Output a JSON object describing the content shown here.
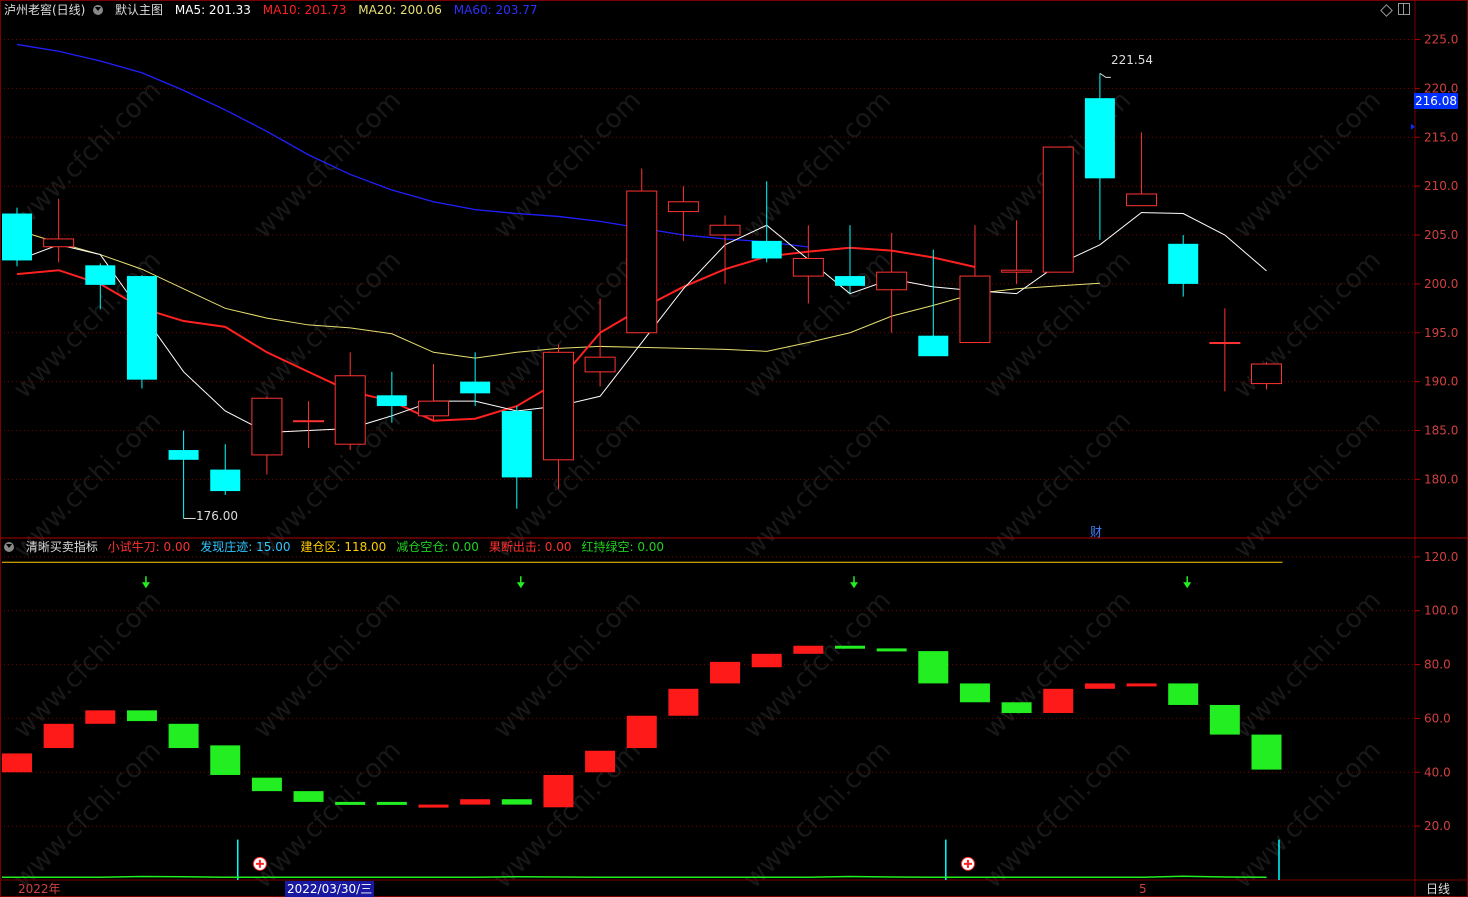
{
  "header": {
    "stock_name": "泸州老窖(日线)",
    "main_chart_label": "默认主图",
    "ma5_label": "MA5: 201.33",
    "ma10_label": "MA10: 201.73",
    "ma20_label": "MA20: 200.06",
    "ma60_label": "MA60: 203.77"
  },
  "indicator_header": {
    "name": "清晰买卖指标",
    "items": [
      {
        "text": "小试牛刀: 0.00",
        "color": "#ff3030"
      },
      {
        "text": "发现庄迹: 15.00",
        "color": "#2ec8ff"
      },
      {
        "text": "建仓区: 118.00",
        "color": "#ffcc00"
      },
      {
        "text": "减仓空仓: 0.00",
        "color": "#20d020"
      },
      {
        "text": "果断出击: 0.00",
        "color": "#ff3030"
      },
      {
        "text": "红持绿空: 0.00",
        "color": "#20d020"
      }
    ]
  },
  "price_tag": "216.08",
  "max_label": "221.54",
  "min_label": "176.00",
  "fin_marker": "财",
  "dates": {
    "start": "2022年",
    "cursor": "2022/03/30/三",
    "mark": "5"
  },
  "period_label": "日线",
  "watermark": "www.cfchi.com",
  "colors": {
    "up": "#ff3232",
    "down": "#00ffff",
    "ma5": "#ffffff",
    "ma10": "#ff2020",
    "ma20": "#e8e070",
    "ma60": "#2020ff",
    "grid": "#7a0000"
  },
  "chart_data": [
    {
      "type": "candlestick",
      "title": "泸州老窖(日线)",
      "ylim": [
        174,
        227
      ],
      "yticks": [
        "225.0",
        "220.0",
        "215.0",
        "210.0",
        "205.0",
        "200.0",
        "195.0",
        "190.0",
        "185.0",
        "180.0"
      ],
      "candles": [
        {
          "o": 207.2,
          "c": 202.4,
          "h": 207.8,
          "l": 201.8
        },
        {
          "o": 203.8,
          "c": 204.6,
          "h": 208.7,
          "l": 202.2
        },
        {
          "o": 201.9,
          "c": 199.9,
          "h": 202.1,
          "l": 197.4
        },
        {
          "o": 200.8,
          "c": 190.2,
          "h": 200.9,
          "l": 189.3
        },
        {
          "o": 183.0,
          "c": 182.0,
          "h": 185.0,
          "l": 176.0
        },
        {
          "o": 181.0,
          "c": 178.8,
          "h": 183.6,
          "l": 178.4
        },
        {
          "o": 182.5,
          "c": 188.3,
          "h": 188.5,
          "l": 180.5
        },
        {
          "o": 186.0,
          "c": 186.0,
          "h": 188.0,
          "l": 183.2
        },
        {
          "o": 183.6,
          "c": 190.6,
          "h": 193.0,
          "l": 183.0
        },
        {
          "o": 188.6,
          "c": 187.5,
          "h": 191.0,
          "l": 185.8
        },
        {
          "o": 186.5,
          "c": 188.0,
          "h": 191.8,
          "l": 186.0
        },
        {
          "o": 190.0,
          "c": 188.8,
          "h": 193.0,
          "l": 187.5
        },
        {
          "o": 187.0,
          "c": 180.2,
          "h": 187.5,
          "l": 177.0
        },
        {
          "o": 182.0,
          "c": 193.0,
          "h": 193.8,
          "l": 179.0
        },
        {
          "o": 191.0,
          "c": 192.5,
          "h": 198.5,
          "l": 189.5
        },
        {
          "o": 195.0,
          "c": 209.5,
          "h": 211.8,
          "l": 195.0
        },
        {
          "o": 207.4,
          "c": 208.4,
          "h": 210.0,
          "l": 204.4
        },
        {
          "o": 205.0,
          "c": 206.0,
          "h": 207.0,
          "l": 200.0
        },
        {
          "o": 204.4,
          "c": 202.6,
          "h": 210.5,
          "l": 202.2
        },
        {
          "o": 200.8,
          "c": 202.6,
          "h": 206.0,
          "l": 198.0
        },
        {
          "o": 200.8,
          "c": 199.8,
          "h": 206.0,
          "l": 199.0
        },
        {
          "o": 199.4,
          "c": 201.2,
          "h": 205.2,
          "l": 195.0
        },
        {
          "o": 194.7,
          "c": 192.6,
          "h": 203.5,
          "l": 192.6
        },
        {
          "o": 194.0,
          "c": 200.8,
          "h": 206.0,
          "l": 194.0
        },
        {
          "o": 201.2,
          "c": 201.4,
          "h": 206.5,
          "l": 200.0
        },
        {
          "o": 201.2,
          "c": 214.0,
          "h": 214.0,
          "l": 201.2
        },
        {
          "o": 219.0,
          "c": 210.8,
          "h": 221.54,
          "l": 204.5
        },
        {
          "o": 208.0,
          "c": 209.2,
          "h": 215.5,
          "l": 208.0
        },
        {
          "o": 204.1,
          "c": 200.0,
          "h": 205.0,
          "l": 198.7
        },
        {
          "o": 194.0,
          "c": 194.0,
          "h": 197.5,
          "l": 189.0
        },
        {
          "o": 189.8,
          "c": 191.8,
          "h": 192.0,
          "l": 189.2
        }
      ],
      "ma5": [
        202.4,
        204.0,
        203.0,
        197.0,
        191.0,
        187.0,
        184.8,
        185.0,
        185.2,
        186.5,
        188.0,
        188.0,
        187.0,
        187.5,
        188.5,
        194.0,
        199.5,
        204.0,
        206.0,
        202.5,
        199.0,
        200.5,
        199.7,
        199.3,
        199.0,
        202.0,
        204.0,
        207.3,
        207.2,
        205.0,
        201.33
      ],
      "ma10": [
        201.0,
        201.4,
        200.0,
        197.5,
        196.2,
        195.6,
        193.0,
        191.0,
        189.0,
        188.0,
        186.0,
        186.2,
        187.5,
        190.0,
        195.0,
        197.5,
        199.7,
        201.5,
        202.8,
        203.3,
        203.7,
        203.4,
        202.7,
        201.73
      ],
      "ma20": [
        205.5,
        204.2,
        203.0,
        201.5,
        199.5,
        197.5,
        196.5,
        195.8,
        195.5,
        194.9,
        193.0,
        192.4,
        193.0,
        193.4,
        193.6,
        193.5,
        193.4,
        193.3,
        193.1,
        194.0,
        195.0,
        196.7,
        197.8,
        199.0,
        199.5,
        199.8,
        200.06
      ],
      "ma60": [
        224.5,
        223.8,
        222.8,
        221.6,
        219.8,
        217.8,
        215.6,
        213.2,
        211.2,
        209.6,
        208.4,
        207.6,
        207.2,
        206.9,
        206.4,
        205.7,
        205.0,
        204.6,
        204.3,
        203.77
      ]
    },
    {
      "type": "bar",
      "title": "清晰买卖指标",
      "ylim": [
        0,
        127
      ],
      "yticks": [
        "120.0",
        "100.0",
        "80.0",
        "60.0",
        "40.0",
        "20.0"
      ],
      "boxes": [
        {
          "a": 40,
          "b": 47,
          "color": "red"
        },
        {
          "a": 49,
          "b": 58,
          "color": "red"
        },
        {
          "a": 58,
          "b": 63,
          "color": "red"
        },
        {
          "a": 63,
          "b": 59,
          "color": "green"
        },
        {
          "a": 58,
          "b": 49,
          "color": "green"
        },
        {
          "a": 50,
          "b": 39,
          "color": "green"
        },
        {
          "a": 38,
          "b": 33,
          "color": "green"
        },
        {
          "a": 33,
          "b": 29,
          "color": "green"
        },
        {
          "a": 29,
          "b": 28,
          "color": "green"
        },
        {
          "a": 29,
          "b": 28,
          "color": "green"
        },
        {
          "a": 27,
          "b": 28,
          "color": "red"
        },
        {
          "a": 28,
          "b": 30,
          "color": "red"
        },
        {
          "a": 30,
          "b": 28,
          "color": "green"
        },
        {
          "a": 27,
          "b": 39,
          "color": "red"
        },
        {
          "a": 40,
          "b": 48,
          "color": "red"
        },
        {
          "a": 49,
          "b": 61,
          "color": "red"
        },
        {
          "a": 61,
          "b": 71,
          "color": "red"
        },
        {
          "a": 73,
          "b": 81,
          "color": "red"
        },
        {
          "a": 79,
          "b": 84,
          "color": "red"
        },
        {
          "a": 84,
          "b": 87,
          "color": "red"
        },
        {
          "a": 87,
          "b": 86,
          "color": "green"
        },
        {
          "a": 86,
          "b": 85,
          "color": "green"
        },
        {
          "a": 85,
          "b": 73,
          "color": "green"
        },
        {
          "a": 73,
          "b": 66,
          "color": "green"
        },
        {
          "a": 66,
          "b": 62,
          "color": "green"
        },
        {
          "a": 62,
          "b": 71,
          "color": "red"
        },
        {
          "a": 71,
          "b": 73,
          "color": "red"
        },
        {
          "a": 73,
          "b": 73,
          "color": "red"
        },
        {
          "a": 73,
          "b": 65,
          "color": "green"
        },
        {
          "a": 65,
          "b": 54,
          "color": "green"
        },
        {
          "a": 54,
          "b": 41,
          "color": "green"
        }
      ],
      "threshold": 118,
      "down_arrows": [
        3,
        12,
        20,
        28
      ],
      "cyan_spikes": [
        {
          "i": 5,
          "v": 15
        },
        {
          "i": 22,
          "v": 15
        },
        {
          "i": 30,
          "v": 15
        }
      ],
      "cross_marks": [
        6,
        23
      ],
      "green_baseline": [
        1,
        1,
        1,
        1.3,
        1.2,
        1,
        1,
        1,
        1,
        1,
        1,
        1,
        1.2,
        1.1,
        1,
        1,
        1,
        1,
        1,
        1,
        1.3,
        1.1,
        1,
        1,
        1,
        1,
        1,
        1,
        1.4,
        1.1,
        1
      ]
    }
  ]
}
